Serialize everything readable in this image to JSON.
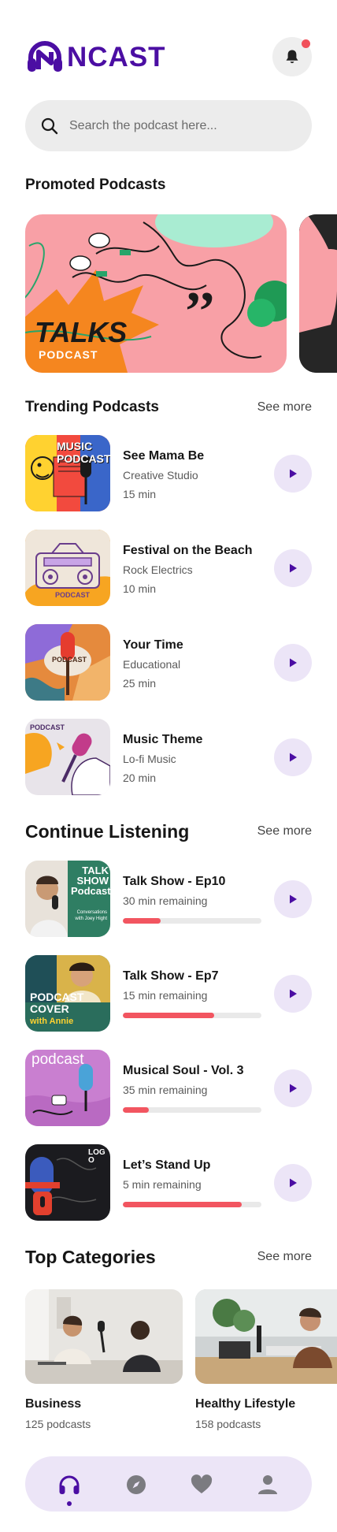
{
  "app": {
    "logo_text": "NCAST",
    "brand_color": "#4b0ea3",
    "accent_color": "#f25560",
    "notification_badge": true
  },
  "search": {
    "placeholder": "Search the podcast here...",
    "icon": "search-icon"
  },
  "promoted": {
    "title": "Promoted Podcasts",
    "cards": [
      {
        "title": "TALKS",
        "subtitle": "PODCAST"
      },
      {
        "title": "",
        "subtitle": ""
      }
    ]
  },
  "trending": {
    "title": "Trending Podcasts",
    "see_more": "See more",
    "items": [
      {
        "title": "See Mama Be",
        "category": "Creative Studio",
        "duration": "15 min",
        "thumb_label": "MUSIC PODCAST"
      },
      {
        "title": "Festival on the Beach",
        "category": "Rock Electrics",
        "duration": "10 min",
        "thumb_label": "PODCAST"
      },
      {
        "title": "Your Time",
        "category": "Educational",
        "duration": "25 min",
        "thumb_label": "PODCAST"
      },
      {
        "title": "Music Theme",
        "category": "Lo-fi Music",
        "duration": "20 min",
        "thumb_label": "PODCAST"
      }
    ]
  },
  "continue": {
    "title": "Continue Listening",
    "see_more": "See more",
    "items": [
      {
        "title": "Talk Show - Ep10",
        "remaining": "30 min remaining",
        "progress": 0.27,
        "thumb_label": "TALK SHOW Podcast.",
        "thumb_sub": "Conversations with Joey Hight"
      },
      {
        "title": "Talk Show - Ep7",
        "remaining": "15 min remaining",
        "progress": 0.66,
        "thumb_label": "PODCAST COVER",
        "thumb_sub": "with Annie"
      },
      {
        "title": "Musical Soul - Vol. 3",
        "remaining": "35 min remaining",
        "progress": 0.19,
        "thumb_label": "podcast",
        "thumb_sub": ""
      },
      {
        "title": "Let’s Stand Up",
        "remaining": "5 min remaining",
        "progress": 0.86,
        "thumb_label": "LOGO",
        "thumb_sub": ""
      }
    ]
  },
  "categories": {
    "title": "Top Categories",
    "see_more": "See more",
    "items": [
      {
        "title": "Business",
        "count": "125 podcasts"
      },
      {
        "title": "Healthy Lifestyle",
        "count": "158 podcasts"
      }
    ]
  },
  "nav": {
    "items": [
      "headphones-icon",
      "compass-icon",
      "heart-icon",
      "user-icon"
    ],
    "active": 0
  }
}
